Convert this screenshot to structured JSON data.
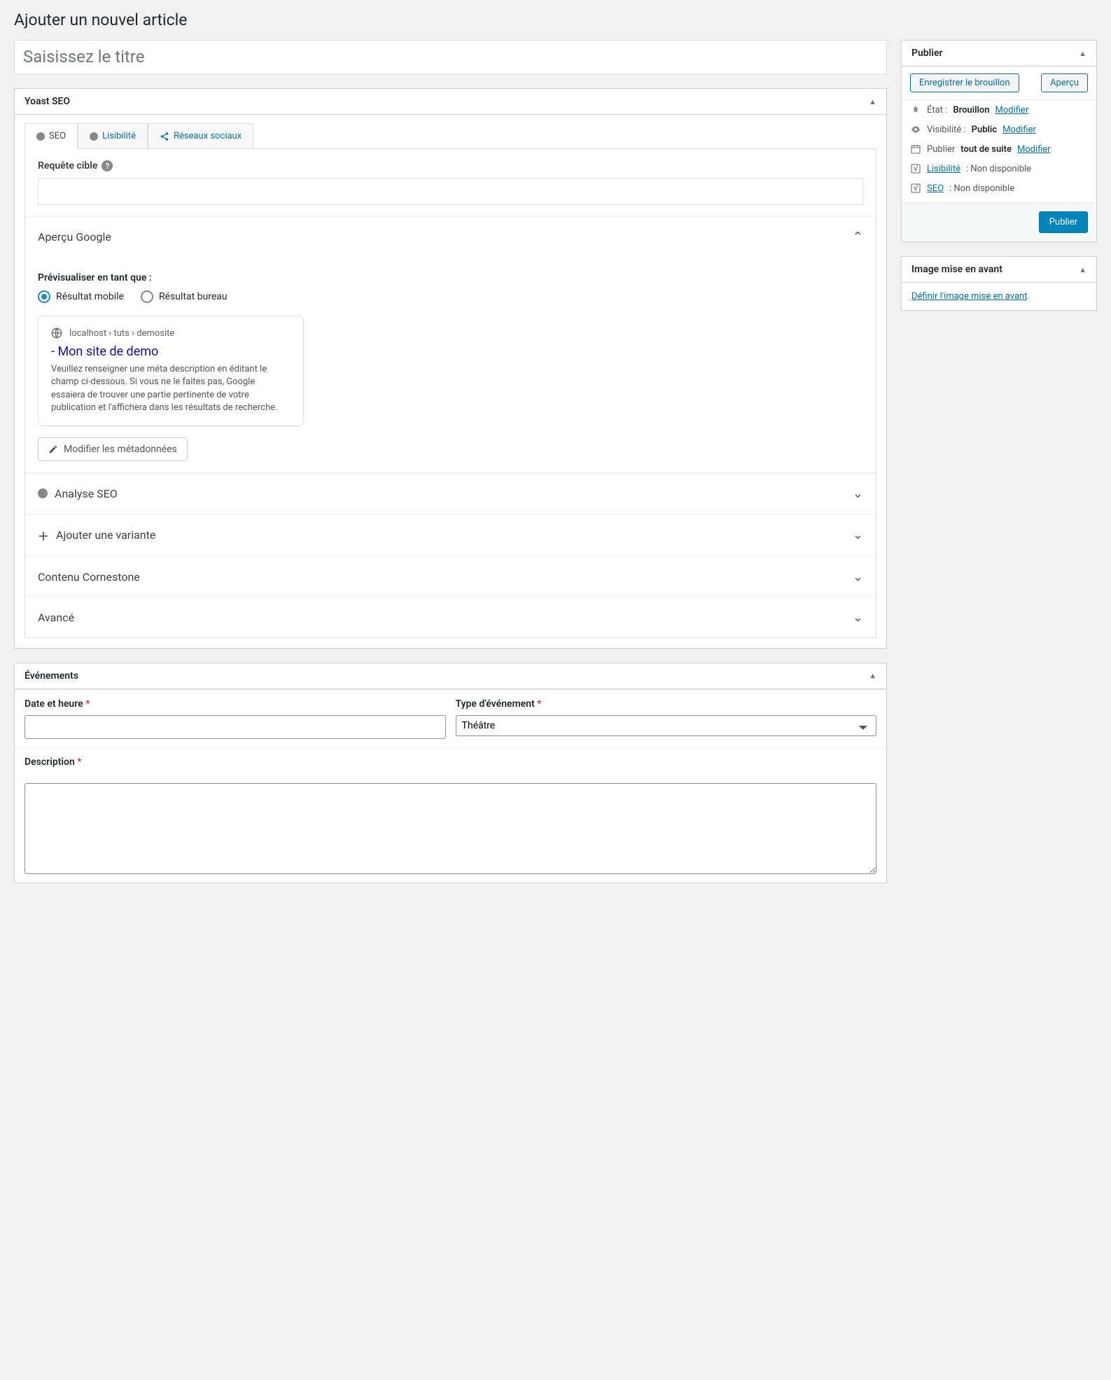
{
  "page": {
    "title": "Ajouter un nouvel article"
  },
  "editor": {
    "title_placeholder": "Saisissez le titre"
  },
  "yoast": {
    "box_title": "Yoast SEO",
    "tabs": {
      "seo": "SEO",
      "readability": "Lisibilité",
      "social": "Réseaux sociaux"
    },
    "focus": {
      "label": "Requête cible"
    },
    "google": {
      "heading": "Aperçu Google",
      "preview_as": "Prévisualiser en tant que :",
      "mobile": "Résultat mobile",
      "desktop": "Résultat bureau",
      "breadcrumb": "localhost › tuts › demosite",
      "title": "- Mon site de demo",
      "description": "Veuillez renseigner une méta description en éditant le champ ci-dessous. Si vous ne le faites pas, Google essaiera de trouver une partie pertinente de votre publication et l'affichera dans les résultats de recherche.",
      "edit_btn": "Modifier les métadonnées"
    },
    "sections": {
      "analysis": "Analyse SEO",
      "variant": "Ajouter une variante",
      "cornerstone": "Contenu Cornestone",
      "advanced": "Avancé"
    }
  },
  "events": {
    "box_title": "Événements",
    "datetime_label": "Date et heure",
    "type_label": "Type d'événement",
    "type_value": "Théâtre",
    "description_label": "Description"
  },
  "publish": {
    "box_title": "Publier",
    "save_draft": "Enregistrer le brouillon",
    "preview": "Aperçu",
    "status_label": "État :",
    "status_value": "Brouillon",
    "visibility_label": "Visibilité :",
    "visibility_value": "Public",
    "schedule_label": "Publier",
    "schedule_value": "tout de suite",
    "readability_label": "Lisibilité",
    "readability_value": ": Non disponible",
    "seo_label": "SEO",
    "seo_value": ": Non disponible",
    "modify": "Modifier",
    "publish_btn": "Publier"
  },
  "featured": {
    "box_title": "Image mise en avant",
    "link": "Définir l'image mise en avant"
  }
}
